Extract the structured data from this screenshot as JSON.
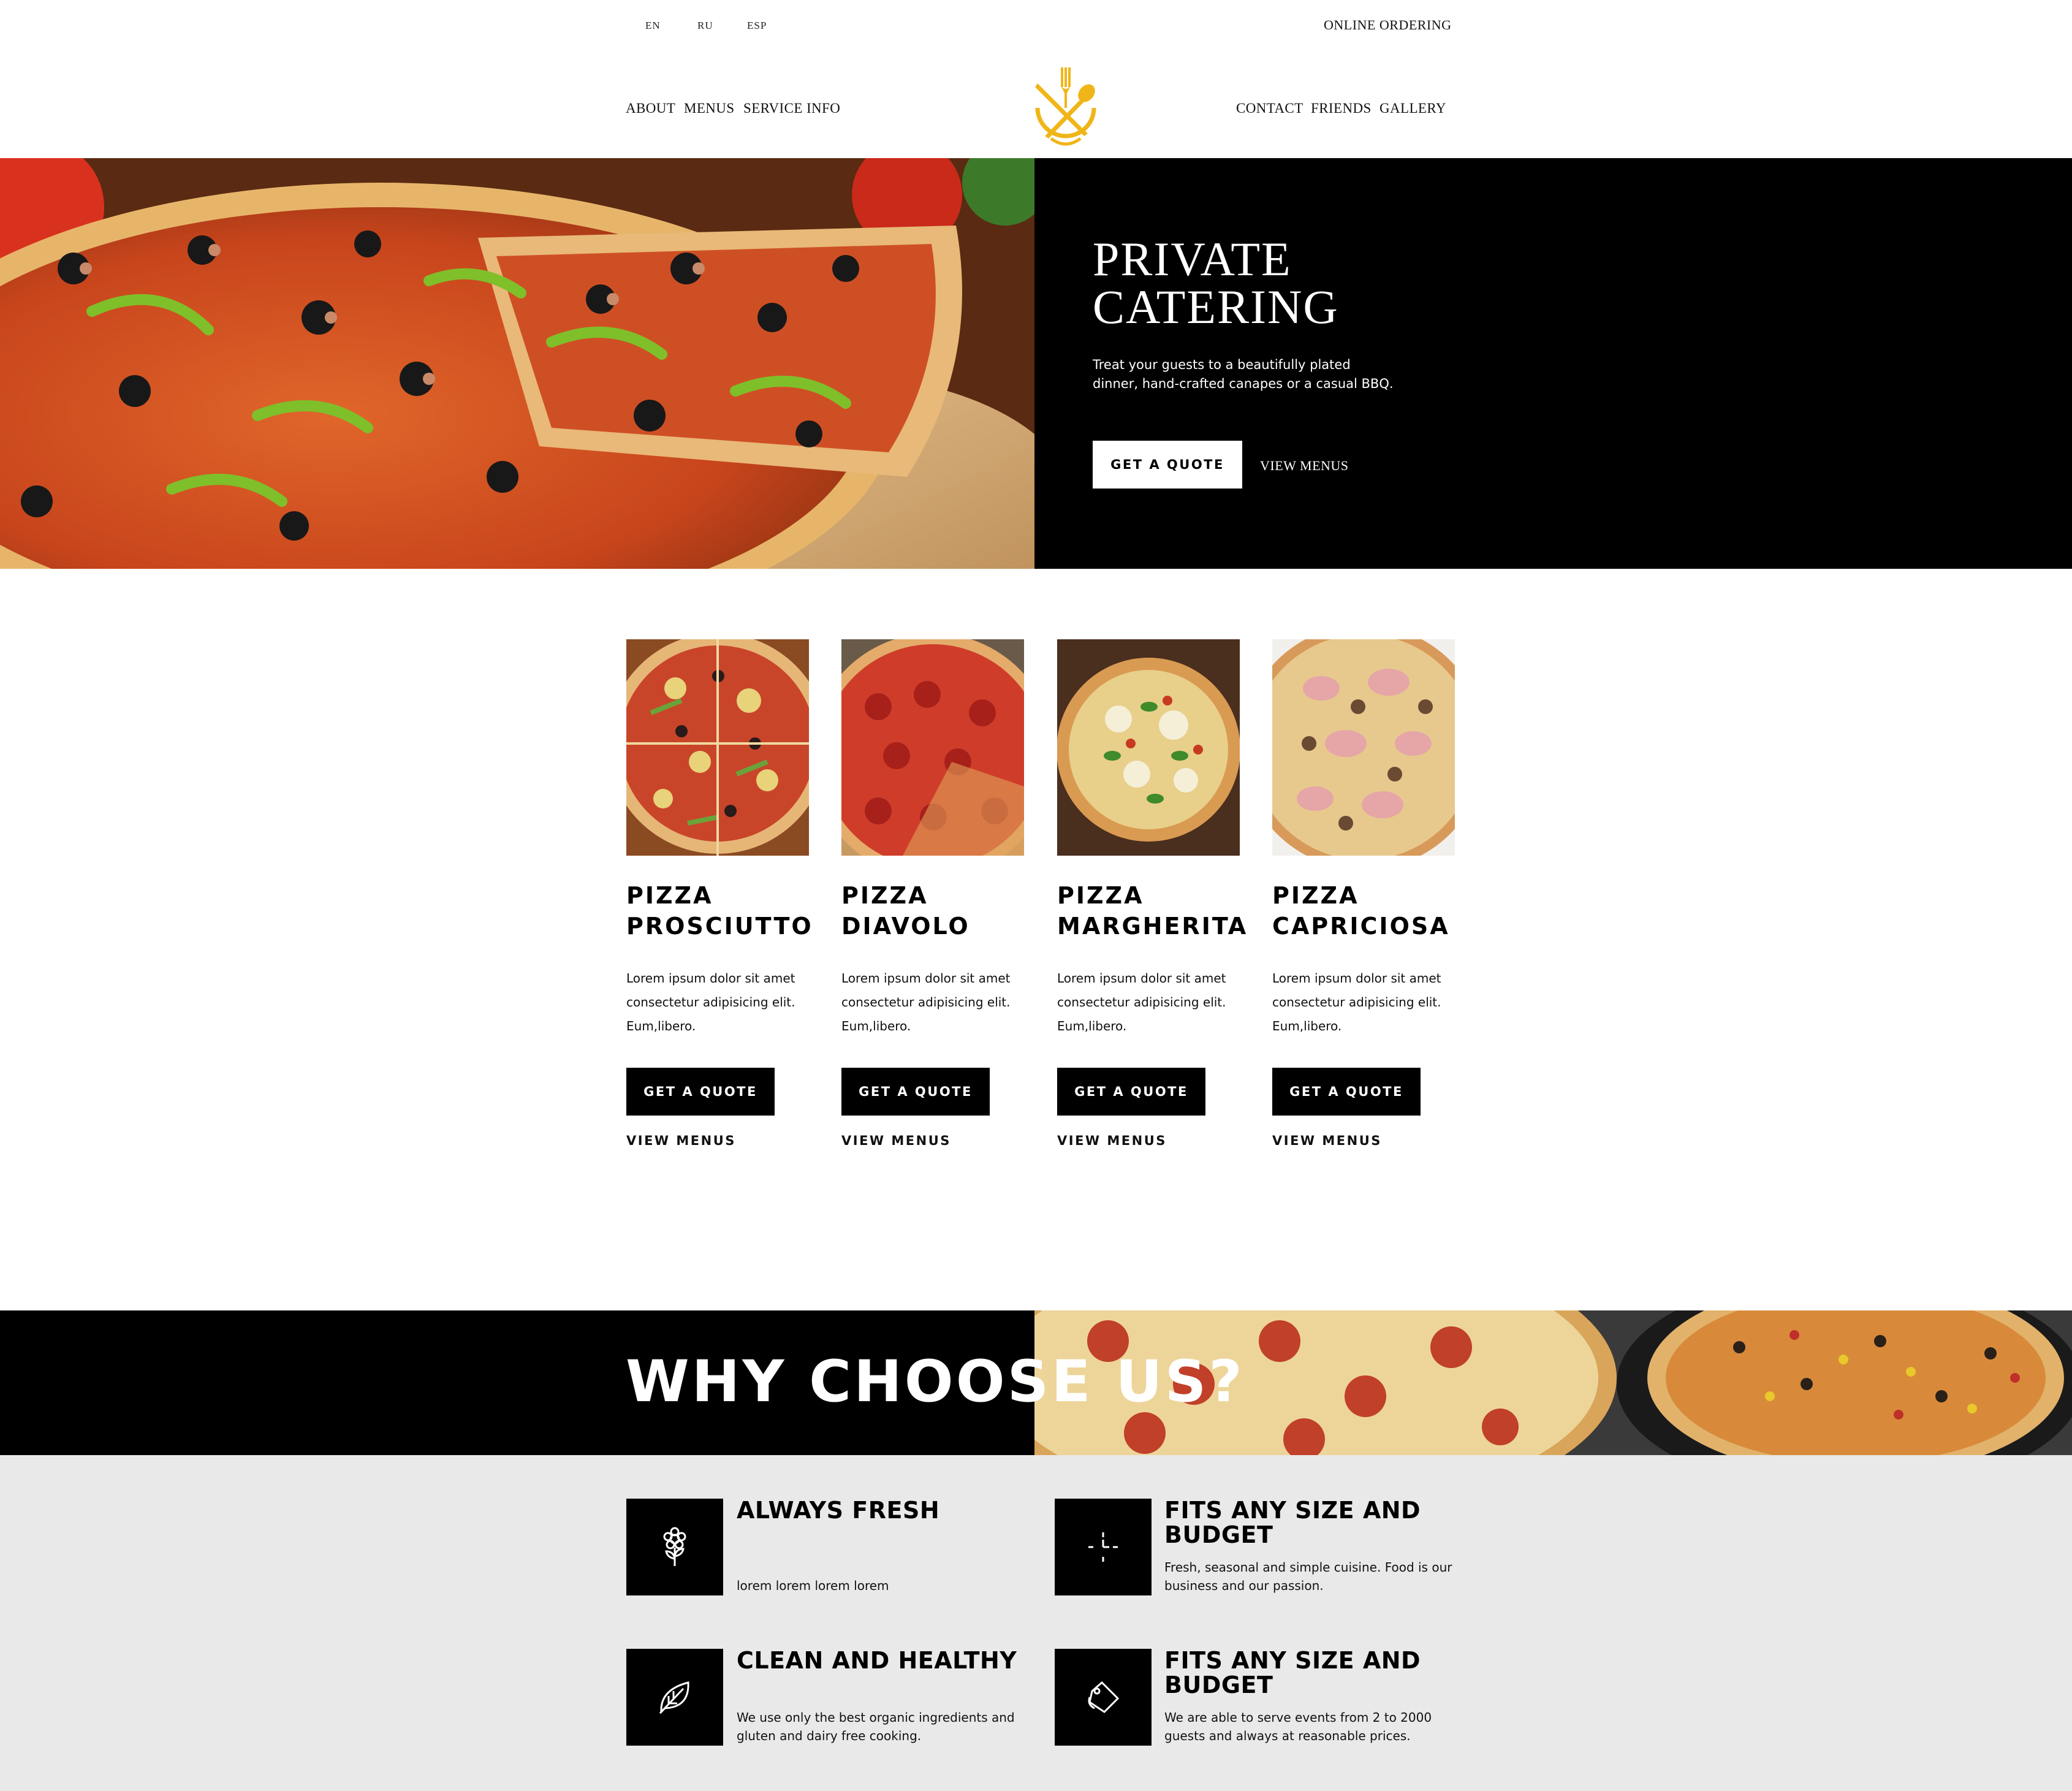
{
  "header": {
    "languages": [
      "EN",
      "RU",
      "ESP"
    ],
    "online_ordering": "ONLINE ORDERING",
    "nav_left": [
      "ABOUT",
      "MENUS",
      "SERVICE INFO"
    ],
    "nav_right": [
      "CONTACT",
      "FRIENDS",
      "GALLERY"
    ]
  },
  "hero": {
    "title_line1": "PRIVATE",
    "title_line2": "CATERING",
    "desc_line1": "Treat your guests to a beautifully plated",
    "desc_line2": "dinner, hand-crafted canapes or a casual BBQ.",
    "quote_button": "GET A QUOTE",
    "view_menus": "VIEW MENUS"
  },
  "products": [
    {
      "line1": "PIZZA",
      "line2": "PROSCIUTTO",
      "desc1": "Lorem ipsum dolor sit amet",
      "desc2": "consectetur adipisicing elit.",
      "desc3": "Eum,libero.",
      "button": "GET A QUOTE",
      "link": "VIEW MENUS"
    },
    {
      "line1": "PIZZA",
      "line2": "DIAVOLO",
      "desc1": "Lorem ipsum dolor sit amet",
      "desc2": "consectetur adipisicing elit.",
      "desc3": "Eum,libero.",
      "button": "GET A QUOTE",
      "link": "VIEW MENUS"
    },
    {
      "line1": "PIZZA",
      "line2": "MARGHERITA",
      "desc1": "Lorem ipsum dolor sit amet",
      "desc2": "consectetur adipisicing elit.",
      "desc3": "Eum,libero.",
      "button": "GET A QUOTE",
      "link": "VIEW MENUS"
    },
    {
      "line1": "PIZZA",
      "line2": "CAPRICIOSA",
      "desc1": "Lorem ipsum dolor sit amet",
      "desc2": "consectetur adipisicing elit.",
      "desc3": "Eum,libero.",
      "button": "GET A QUOTE",
      "link": "VIEW MENUS"
    }
  ],
  "why": {
    "title": "WHY CHOOSE US?"
  },
  "features": [
    {
      "icon": "flower-icon",
      "title1": "ALWAYS FRESH",
      "title2": "",
      "desc1": "lorem lorem lorem lorem",
      "desc2": ""
    },
    {
      "icon": "clock-icon",
      "title1": "FITS ANY SIZE AND",
      "title2": "BUDGET",
      "desc1": "Fresh, seasonal and simple cuisine. Food is our",
      "desc2": "business and our passion."
    },
    {
      "icon": "leaf-icon",
      "title1": "CLEAN AND HEALTHY",
      "title2": "",
      "desc1": "We use only the best organic ingredients and",
      "desc2": "gluten and dairy free cooking."
    },
    {
      "icon": "tag-icon",
      "title1": "FITS ANY SIZE AND",
      "title2": "BUDGET",
      "desc1": "We are able to serve events from 2 to 2000",
      "desc2": "guests and always at reasonable prices."
    }
  ],
  "colors": {
    "logo_gold": "#f0b518",
    "dark": "#000000",
    "feature_bg": "#e9e9e9"
  }
}
